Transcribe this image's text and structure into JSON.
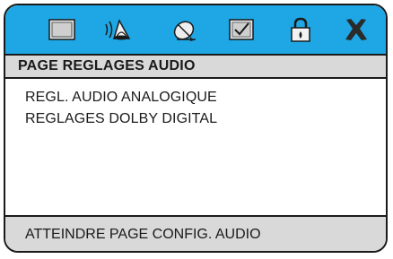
{
  "icon_bar": {
    "icons": [
      "screen-icon",
      "audio-speaker-icon",
      "satellite-dish-icon",
      "checklist-icon",
      "lock-icon",
      "close-icon"
    ],
    "background": "#1ea7e4"
  },
  "title": "PAGE REGLAGES AUDIO",
  "items": [
    {
      "label": "REGL. AUDIO ANALOGIQUE"
    },
    {
      "label": "REGLAGES DOLBY DIGITAL"
    }
  ],
  "status": "ATTEINDRE PAGE CONFIG. AUDIO"
}
